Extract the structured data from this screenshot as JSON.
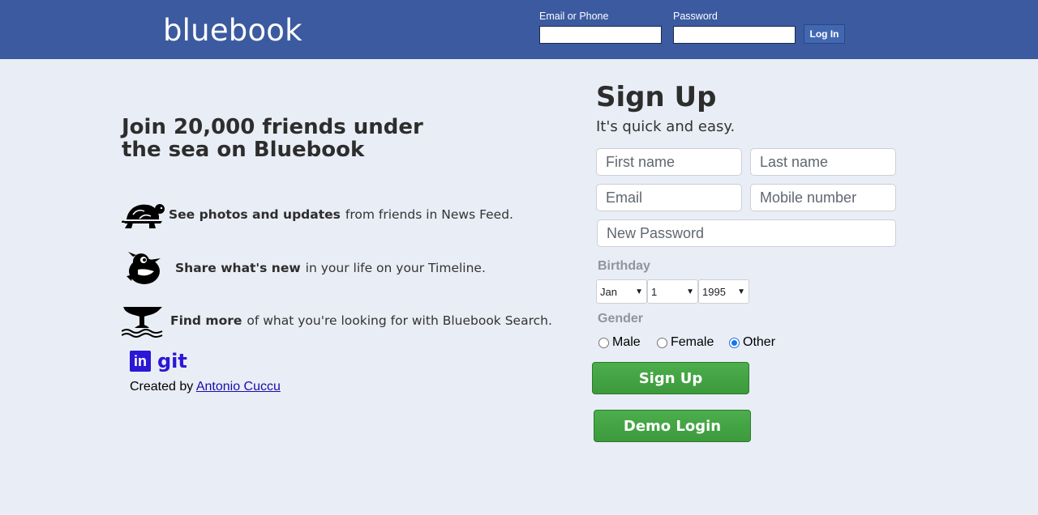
{
  "header": {
    "brand": "bluebook",
    "email_label": "Email or Phone",
    "password_label": "Password",
    "login_button": "Log In"
  },
  "intro": {
    "headline": "Join 20,000 friends under the sea on Bluebook",
    "features": [
      {
        "icon": "turtle-icon",
        "bold": "See photos and updates",
        "text": "from friends in News Feed."
      },
      {
        "icon": "bird-icon",
        "bold": "Share what's new",
        "text": "in your life on your Timeline."
      },
      {
        "icon": "whale-tail-icon",
        "bold": "Find more",
        "text": "of what you're looking for with Bluebook Search."
      }
    ],
    "linkedin_icon": "linkedin-icon",
    "linkedin_label": "in",
    "git_label": "git",
    "credit_prefix": "Created by",
    "credit_name": "Antonio Cuccu"
  },
  "signup": {
    "title": "Sign Up",
    "subtitle": "It's quick and easy.",
    "first_name_placeholder": "First name",
    "last_name_placeholder": "Last name",
    "email_placeholder": "Email",
    "mobile_placeholder": "Mobile number",
    "password_placeholder": "New Password",
    "birthday_label": "Birthday",
    "birthday_month": "Jan",
    "birthday_day": "1",
    "birthday_year": "1995",
    "gender_label": "Gender",
    "gender_options": [
      "Male",
      "Female",
      "Other"
    ],
    "gender_selected": "Other",
    "signup_button": "Sign Up",
    "demo_button": "Demo Login"
  },
  "colors": {
    "header_bg": "#3b5aa0",
    "page_bg": "#e9edf5",
    "button_green": "#42a342",
    "link_purple": "#2b17d6"
  }
}
